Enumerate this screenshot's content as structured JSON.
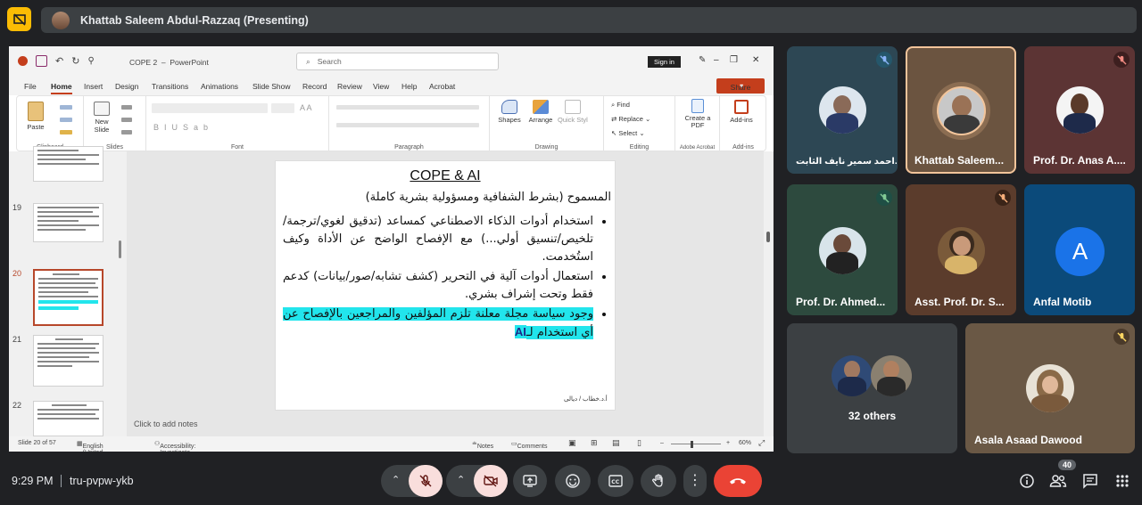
{
  "top": {
    "presenter": "Khattab Saleem Abdul-Razzaq (Presenting)"
  },
  "ppt": {
    "doc_title": "COPE 2",
    "app_name": "PowerPoint",
    "search_placeholder": "Search",
    "sign_in": "Sign in",
    "menu": [
      "File",
      "Home",
      "Insert",
      "Design",
      "Transitions",
      "Animations",
      "Slide Show",
      "Record",
      "Review",
      "View",
      "Help",
      "Acrobat"
    ],
    "share": "Share",
    "ribbon": {
      "paste": "Paste",
      "new_slide": "New Slide",
      "clipboard": "Clipboard",
      "slides": "Slides",
      "font": "Font",
      "paragraph": "Paragraph",
      "shapes": "Shapes",
      "arrange": "Arrange",
      "quick_styles": "Quick Styles",
      "drawing": "Drawing",
      "find": "Find",
      "replace": "Replace",
      "select": "Select",
      "editing": "Editing",
      "create_pdf": "Create a PDF",
      "adobe_acrobat": "Adobe Acrobat",
      "add_ins": "Add-ins",
      "add_ins_group": "Add-ins"
    },
    "thumbs": [
      "19",
      "20",
      "21",
      "22"
    ],
    "slide": {
      "title": "COPE & AI",
      "subtitle": "المسموح (بشرط الشفافية ومسؤولية بشرية كاملة)",
      "bullet1": "استخدام أدوات الذكاء الاصطناعي كمساعد (تدقيق لغوي/ترجمة/تلخيص/تنسيق أولي...) مع الإفصاح الواضح عن الأداة وكيف استُخدمت.",
      "bullet2": "استعمال أدوات آلية في التحرير (كشف تشابه/صور/بيانات) كدعم فقط وتحت إشراف بشري.",
      "bullet3_main": "وجود سياسة مجلة معلنة تلزم المؤلفين والمراجعين بالإفصاح عن أي استخدام لـ",
      "bullet3_ai": "AI",
      "footer": "أ.د.خطاب / ديالى"
    },
    "notes_placeholder": "Click to add notes",
    "status": {
      "slide_of": "Slide 20 of 57",
      "language": "English (United States)",
      "accessibility": "Accessibility: Investigate",
      "notes": "Notes",
      "comments": "Comments",
      "zoom": "60%"
    }
  },
  "participants": [
    {
      "name": "احمد سمير نايف الثابت...",
      "muted": true
    },
    {
      "name": "Khattab Saleem...",
      "muted": false
    },
    {
      "name": "Prof. Dr. Anas A....",
      "muted": true
    },
    {
      "name": "Prof. Dr. Ahmed...",
      "muted": true
    },
    {
      "name": "Asst. Prof. Dr. S...",
      "muted": true
    },
    {
      "name": "Anfal Motib",
      "muted": false,
      "initial": "A"
    },
    {
      "name": "32 others"
    },
    {
      "name": "Asala Asaad Dawood",
      "muted": true
    }
  ],
  "bottom": {
    "time": "9:29 PM",
    "meeting_code": "tru-pvpw-ykb",
    "people_count": "40"
  },
  "colors": {
    "background": "#202124",
    "danger": "#ea4335",
    "muted_btn": "#f9dedc",
    "slide_highlight": "#22e5ec",
    "ppt_accent": "#c43e1c"
  }
}
